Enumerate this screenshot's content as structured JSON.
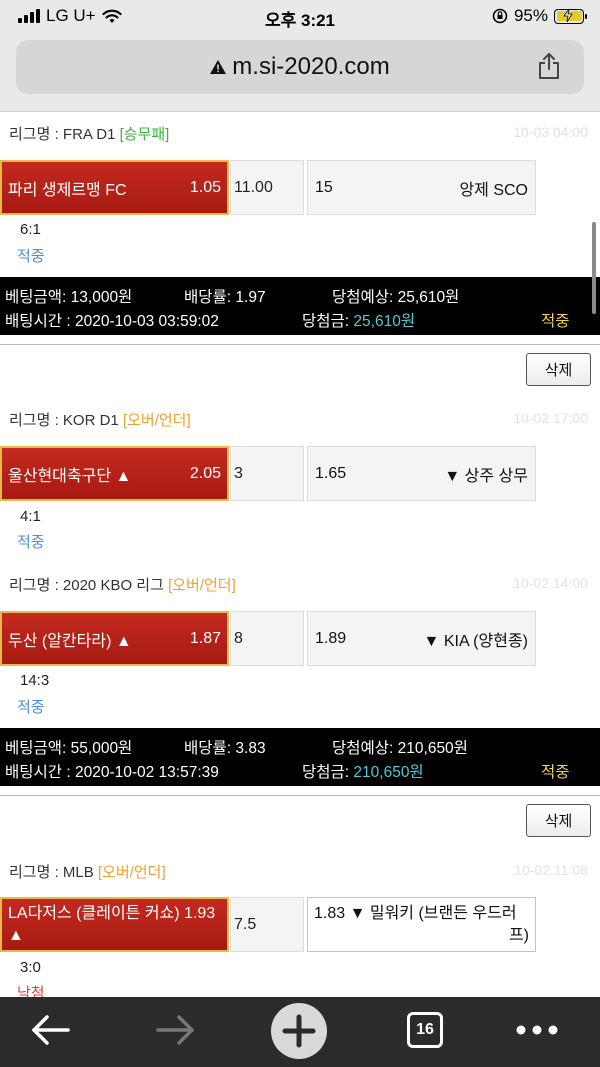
{
  "status_bar": {
    "carrier": "LG U+",
    "time": "오후 3:21",
    "battery": "95%"
  },
  "url_bar": {
    "url": "m.si-2020.com"
  },
  "bets": [
    {
      "matches": [
        {
          "league_label": "리그명 : FRA D1",
          "league_tag": "[승무패]",
          "date": "10-03 04:00",
          "home_team": "파리 생제르맹 FC",
          "home_odds": "1.05",
          "mid": "11.00",
          "away_odds": "15",
          "away_team": "앙제 SCO",
          "score": "6:1",
          "result": "적중"
        }
      ],
      "summary": {
        "bet_amount": "베팅금액: 13,000원",
        "rate": "배당률: 1.97",
        "expected": "당첨예상: 25,610원",
        "bet_time": "배팅시간 : 2020-10-03 03:59:02",
        "win_label": "당첨금:",
        "win_value": "25,610원",
        "status": "적중"
      }
    },
    {
      "delete_label": "삭제",
      "matches": [
        {
          "league_label": "리그명 : KOR D1",
          "league_tag": "[오버/언더]",
          "date": "10-02 17:00",
          "home_team": "울산현대축구단 ▲",
          "home_odds": "2.05",
          "mid": "3",
          "away_odds": "1.65",
          "away_team": "▼ 상주 상무",
          "score": "4:1",
          "result": "적중"
        },
        {
          "league_label": "리그명 : 2020 KBO 리그",
          "league_tag": "[오버/언더]",
          "date": "10-02 14:00",
          "home_team": "두산 (알칸타라) ▲",
          "home_odds": "1.87",
          "mid": "8",
          "away_odds": "1.89",
          "away_team": "▼ KIA (양현종)",
          "score": "14:3",
          "result": "적중"
        }
      ],
      "summary": {
        "bet_amount": "베팅금액: 55,000원",
        "rate": "배당률: 3.83",
        "expected": "당첨예상: 210,650원",
        "bet_time": "배팅시간 : 2020-10-02 13:57:39",
        "win_label": "당첨금:",
        "win_value": "210,650원",
        "status": "적중"
      }
    },
    {
      "delete_label": "삭제",
      "matches": [
        {
          "league_label": "리그명 : MLB",
          "league_tag": "[오버/언더]",
          "date": "10-02 11:08",
          "home_team": "LA다저스 (클레이튼 커쇼) 1.93",
          "home_team_line2": "▲",
          "mid": "7.5",
          "away_line1": "1.83 ▼ 밀워키 (브랜든 우드러",
          "away_line2": "프)",
          "score": "3:0",
          "result": "낙첨"
        }
      ]
    }
  ],
  "toolbar": {
    "tab_count": "16",
    "icons": [
      "back-arrow-icon",
      "forward-arrow-icon",
      "new-tab-plus-icon",
      "tabs-icon",
      "more-dots-icon"
    ]
  }
}
